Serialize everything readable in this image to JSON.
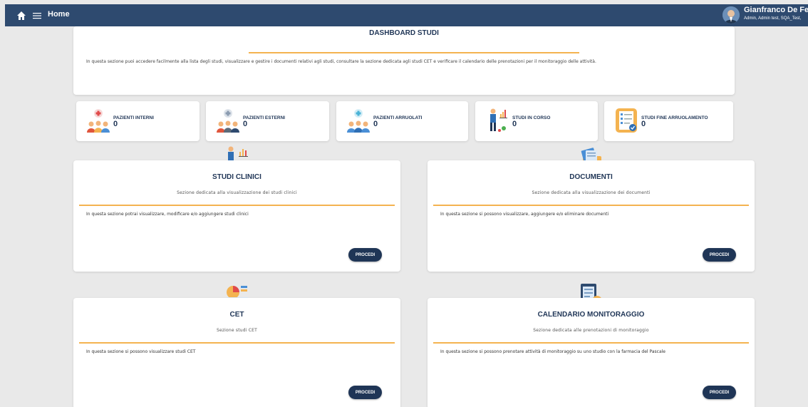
{
  "topbar": {
    "title": "Home",
    "user_name": "Gianfranco De Feo",
    "user_roles": "Admin, Admin test, SQA_Test,",
    "home_icon": "home-icon",
    "menu_icon": "menu-icon",
    "bg_color": "#2e4a6f"
  },
  "dashboard": {
    "title": "DASHBOARD STUDI",
    "description": "In questa sezione puoi accedere facilmente alla lista degli studi, visualizzare e gestire i documenti relativi agli studi, consultare la sezione dedicata agli studi CET e verificare il calendario delle prenotazioni per il monitoraggio delle attività."
  },
  "stats": [
    {
      "label": "PAZIENTI INTERNI",
      "value": "0",
      "icon": "patients-internal-icon"
    },
    {
      "label": "PAZIENTI ESTERNI",
      "value": "0",
      "icon": "patients-external-icon"
    },
    {
      "label": "PAZIENTI ARRUOLATI",
      "value": "0",
      "icon": "patients-enrolled-icon"
    },
    {
      "label": "STUDI IN CORSO",
      "value": "0",
      "icon": "studies-ongoing-icon"
    },
    {
      "label": "STUDI FINE ARRUOLAMENTO",
      "value": "0",
      "icon": "studies-end-enrollment-icon"
    }
  ],
  "sections": [
    {
      "title": "STUDI CLINICI",
      "subtitle": "Sezione dedicata alla visualizzazione dei studi clinici",
      "description": "In questa sezione potrai visualizzare, modificare e/o aggiungere studi clinici",
      "button": "PROCEDI",
      "icon": "clinical-studies-icon"
    },
    {
      "title": "DOCUMENTI",
      "subtitle": "Sezione dedicata alla visualizzazione dei documenti",
      "description": "In questa sezione si possono visualizzare, aggiungere e/o eliminare documenti",
      "button": "PROCEDI",
      "icon": "documents-icon"
    },
    {
      "title": "CET",
      "subtitle": "Sezione studi CET",
      "description": "In questa sezione si possono visualizzare studi CET",
      "button": "PROCEDI",
      "icon": "cet-chart-icon"
    },
    {
      "title": "CALENDARIO MONITORAGGIO",
      "subtitle": "Sezione dedicata alle prenotazioni di monitoraggio",
      "description": "In questa sezione si possono prenotare attività di monitoraggio su uno studio con la farmacia del Pascale",
      "button": "PROCEDI",
      "icon": "calendar-monitoring-icon"
    }
  ],
  "colors": {
    "accent": "#f4b350",
    "navy": "#1f3556",
    "background": "#e9e9e9"
  }
}
